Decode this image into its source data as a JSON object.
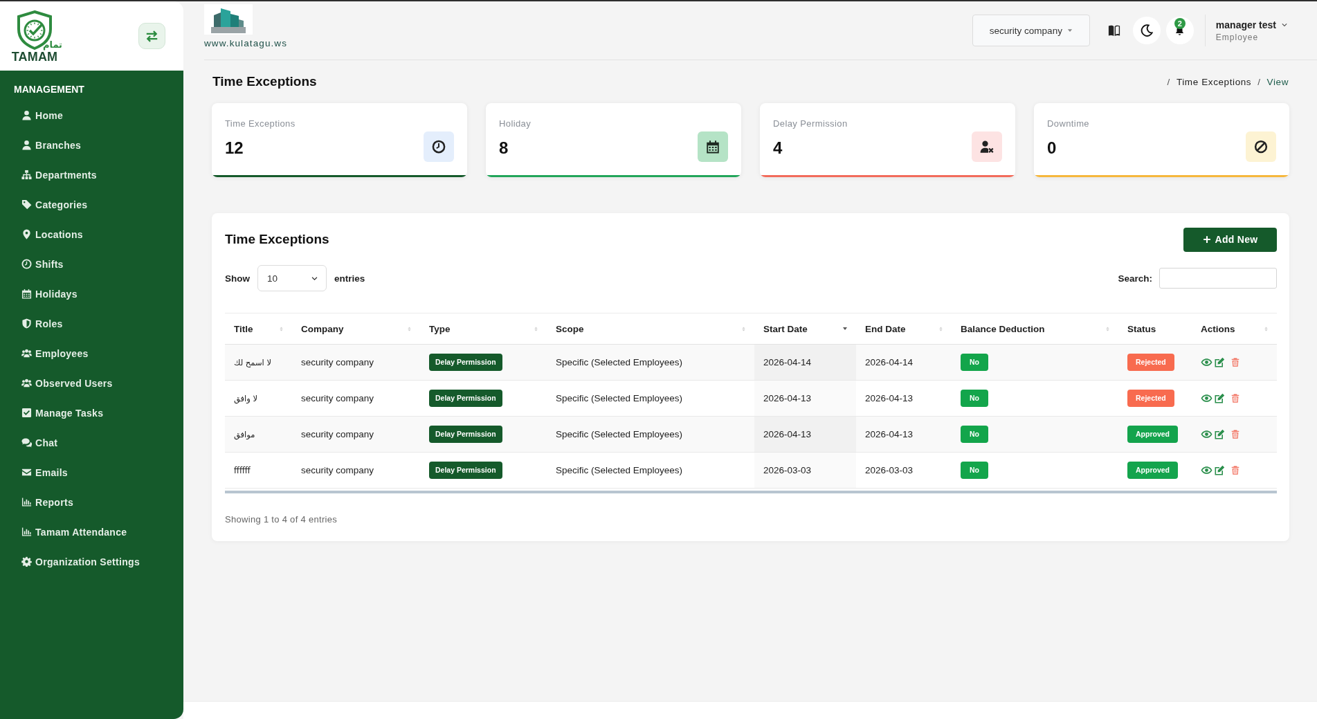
{
  "sidebar": {
    "logo": {
      "arabic_name": "تمام",
      "name": "TAMAM"
    },
    "section_title": "MANAGEMENT",
    "items": [
      {
        "label": "Home",
        "selected": false
      },
      {
        "label": "Branches",
        "selected": false
      },
      {
        "label": "Departments",
        "selected": false
      },
      {
        "label": "Categories",
        "selected": false
      },
      {
        "label": "Locations",
        "selected": false
      },
      {
        "label": "Shifts",
        "selected": false
      },
      {
        "label": "Holidays",
        "selected": false
      },
      {
        "label": "Roles",
        "selected": false
      },
      {
        "label": "Employees",
        "selected": false
      },
      {
        "label": "Observed Users",
        "selected": false
      },
      {
        "label": "Manage Tasks",
        "selected": false
      },
      {
        "label": "Chat",
        "selected": false
      },
      {
        "label": "Emails",
        "selected": false
      },
      {
        "label": "Reports",
        "selected": false
      },
      {
        "label": "Tamam Attendance",
        "selected": false
      },
      {
        "label": "Organization Settings",
        "selected": false
      }
    ]
  },
  "header": {
    "company_website": "www.kulatagu.ws",
    "company_select": "security company",
    "notification_count": "2",
    "user": {
      "name": "manager test",
      "role": "Employee"
    }
  },
  "page_title": "Time Exceptions",
  "breadcrumb": [
    {
      "separator": "/",
      "label": "Time Exceptions",
      "current": false
    },
    {
      "separator": "/",
      "label": "View",
      "current": true
    }
  ],
  "stats": [
    {
      "label": "Time Exceptions",
      "value": "12",
      "color": "#155a2b"
    },
    {
      "label": "Holiday",
      "value": "8",
      "color": "#22a55a"
    },
    {
      "label": "Delay Permission",
      "value": "4",
      "color": "#f26b5b"
    },
    {
      "label": "Downtime",
      "value": "0",
      "color": "#f6b73c"
    }
  ],
  "table_panel": {
    "title": "Time Exceptions",
    "add_button": "Add New",
    "length": {
      "before": "Show",
      "value": "10",
      "after": "entries"
    },
    "search": {
      "label": "Search:"
    },
    "columns": [
      {
        "label": "Title",
        "sortable": true,
        "sorted": false
      },
      {
        "label": "Company",
        "sortable": true,
        "sorted": false
      },
      {
        "label": "Type",
        "sortable": true,
        "sorted": false
      },
      {
        "label": "Scope",
        "sortable": true,
        "sorted": false
      },
      {
        "label": "Start Date",
        "sortable": true,
        "sorted": true
      },
      {
        "label": "End Date",
        "sortable": true,
        "sorted": false
      },
      {
        "label": "Balance Deduction",
        "sortable": true,
        "sorted": false
      },
      {
        "label": "Status",
        "sortable": false,
        "sorted": false
      },
      {
        "label": "Actions",
        "sortable": true,
        "sorted": false
      }
    ],
    "rows": [
      {
        "title": "لا اسمح لك",
        "company": "security company",
        "type": "Delay Permission",
        "scope": "Specific (Selected Employees)",
        "start_date": "2026-04-14",
        "end_date": "2026-04-14",
        "balance_deduction": "No",
        "status": {
          "label": "Rejected",
          "color": "#f86b4f"
        }
      },
      {
        "title": "لا وافق",
        "company": "security company",
        "type": "Delay Permission",
        "scope": "Specific (Selected Employees)",
        "start_date": "2026-04-13",
        "end_date": "2026-04-13",
        "balance_deduction": "No",
        "status": {
          "label": "Rejected",
          "color": "#f86b4f"
        }
      },
      {
        "title": "موافق",
        "company": "security company",
        "type": "Delay Permission",
        "scope": "Specific (Selected Employees)",
        "start_date": "2026-04-13",
        "end_date": "2026-04-13",
        "balance_deduction": "No",
        "status": {
          "label": "Approved",
          "color": "#14a44d"
        }
      },
      {
        "title": "ffffff",
        "company": "security company",
        "type": "Delay Permission",
        "scope": "Specific (Selected Employees)",
        "start_date": "2026-03-03",
        "end_date": "2026-03-03",
        "balance_deduction": "No",
        "status": {
          "label": "Approved",
          "color": "#14a44d"
        }
      }
    ],
    "info": "Showing 1 to 4 of 4 entries"
  }
}
